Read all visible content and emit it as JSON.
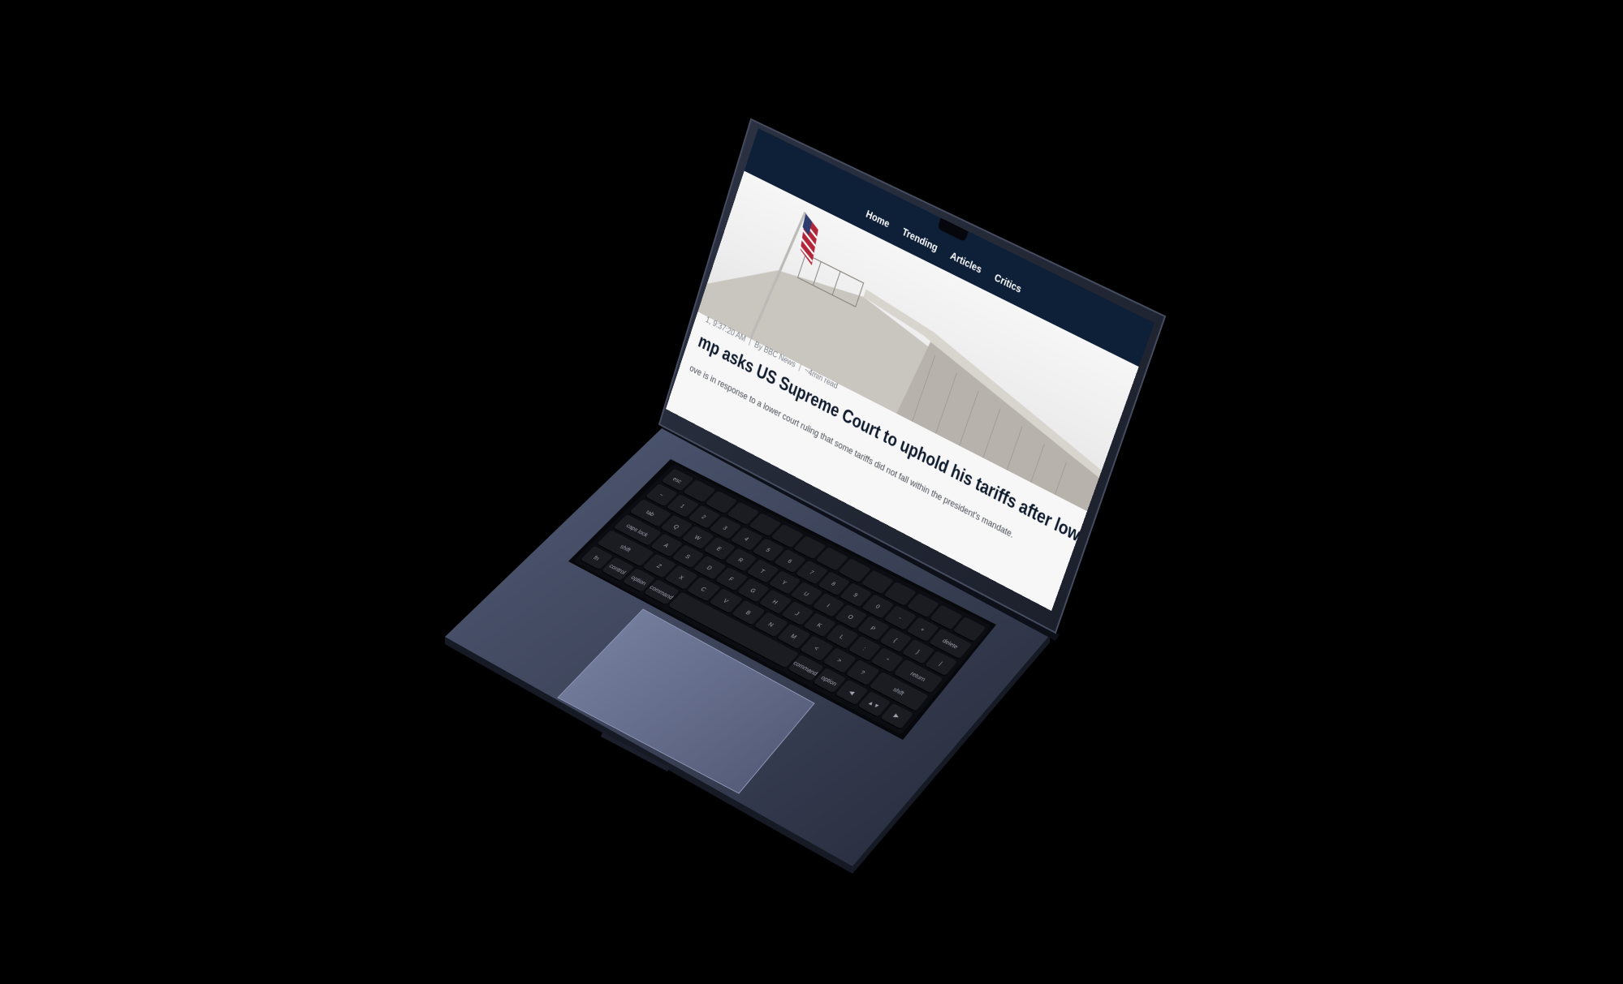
{
  "nav": {
    "items": [
      "Home",
      "Trending",
      "Articles",
      "Critics"
    ]
  },
  "article": {
    "time": "1, 9:37:20 AM",
    "byline": "By BBC News",
    "read_time": "~4min read",
    "title": "mp asks US Supreme Court to uphold his tariffs after lower court defeat -",
    "summary": "ove is in response to a lower court ruling that some tariffs did not fall within the president's mandate."
  },
  "keyboard": {
    "rows": [
      [
        "esc",
        "",
        "",
        "",
        "",
        "",
        "",
        "",
        "",
        "",
        "",
        "",
        "",
        ""
      ],
      [
        "~",
        "1",
        "2",
        "3",
        "4",
        "5",
        "6",
        "7",
        "8",
        "9",
        "0",
        "-",
        "+",
        "delete"
      ],
      [
        "tab",
        "Q",
        "W",
        "E",
        "R",
        "T",
        "Y",
        "U",
        "I",
        "O",
        "P",
        "{",
        "}",
        "|"
      ],
      [
        "caps lock",
        "A",
        "S",
        "D",
        "F",
        "G",
        "H",
        "J",
        "K",
        "L",
        ":",
        "\"",
        "return"
      ],
      [
        "shift",
        "Z",
        "X",
        "C",
        "V",
        "B",
        "N",
        "M",
        "<",
        ">",
        "?",
        "shift"
      ],
      [
        "fn",
        "control",
        "option",
        "command",
        "",
        "command",
        "option",
        "◀",
        "▲▼",
        "▶"
      ]
    ]
  },
  "colors": {
    "navbar": "#0e1f38",
    "laptop_body": "#3b4153",
    "background": "#000000"
  }
}
